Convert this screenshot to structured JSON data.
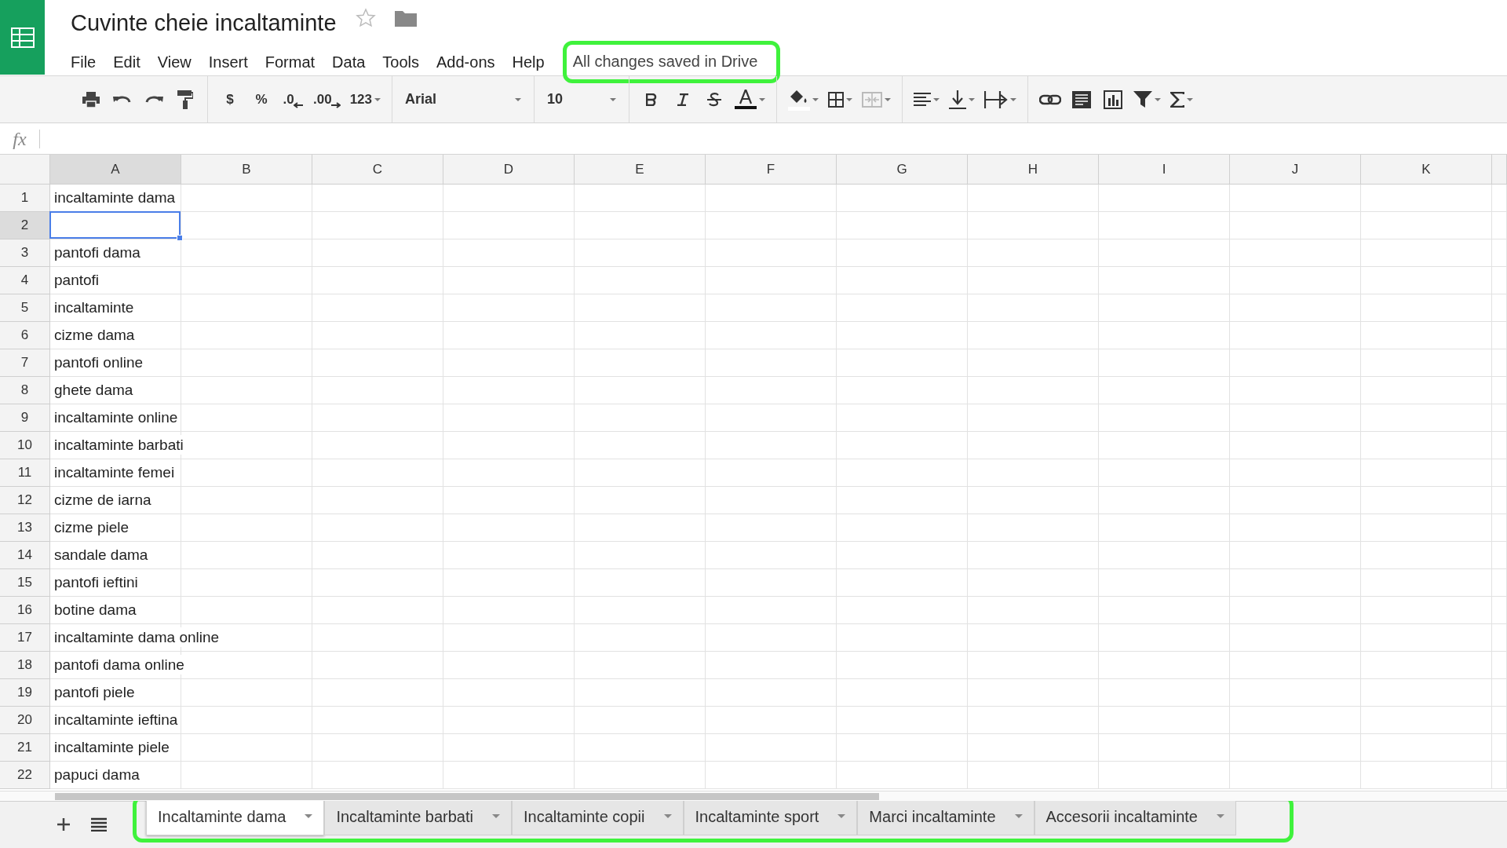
{
  "document": {
    "title": "Cuvinte cheie incaltaminte",
    "starred": false
  },
  "menu": [
    "File",
    "Edit",
    "View",
    "Insert",
    "Format",
    "Data",
    "Tools",
    "Add-ons",
    "Help"
  ],
  "save_status": "All changes saved in Drive",
  "toolbar": {
    "currency": "$",
    "percent": "%",
    "decrease_decimal": ".0",
    "increase_decimal": ".00",
    "number_format": "123",
    "font": "Arial",
    "font_size": "10"
  },
  "formula_bar": {
    "label": "fx"
  },
  "columns": [
    {
      "label": "A",
      "selected": true
    },
    {
      "label": "B",
      "selected": false
    },
    {
      "label": "C",
      "selected": false
    },
    {
      "label": "D",
      "selected": false
    },
    {
      "label": "E",
      "selected": false
    },
    {
      "label": "F",
      "selected": false
    },
    {
      "label": "G",
      "selected": false
    },
    {
      "label": "H",
      "selected": false
    },
    {
      "label": "I",
      "selected": false
    },
    {
      "label": "J",
      "selected": false
    },
    {
      "label": "K",
      "selected": false
    }
  ],
  "rows": [
    {
      "number": "1",
      "value": "incaltaminte dama",
      "selected": false
    },
    {
      "number": "2",
      "selected": true
    },
    {
      "number": "3",
      "value": "pantofi dama",
      "selected": false
    },
    {
      "number": "4",
      "value": "pantofi",
      "selected": false
    },
    {
      "number": "5",
      "value": "incaltaminte",
      "selected": false
    },
    {
      "number": "6",
      "value": "cizme dama",
      "selected": false
    },
    {
      "number": "7",
      "value": "pantofi online",
      "selected": false
    },
    {
      "number": "8",
      "value": "ghete dama",
      "selected": false
    },
    {
      "number": "9",
      "value": "incaltaminte online",
      "selected": false
    },
    {
      "number": "10",
      "value": "incaltaminte barbati",
      "selected": false
    },
    {
      "number": "11",
      "value": "incaltaminte femei",
      "selected": false
    },
    {
      "number": "12",
      "value": "cizme de iarna",
      "selected": false
    },
    {
      "number": "13",
      "value": "cizme piele",
      "selected": false
    },
    {
      "number": "14",
      "value": "sandale dama",
      "selected": false
    },
    {
      "number": "15",
      "value": "pantofi ieftini",
      "selected": false
    },
    {
      "number": "16",
      "value": "botine dama",
      "selected": false
    },
    {
      "number": "17",
      "value": "incaltaminte dama online",
      "selected": false
    },
    {
      "number": "18",
      "value": "pantofi dama online",
      "selected": false
    },
    {
      "number": "19",
      "value": "pantofi piele",
      "selected": false
    },
    {
      "number": "20",
      "value": "incaltaminte ieftina",
      "selected": false
    },
    {
      "number": "21",
      "value": "incaltaminte piele",
      "selected": false
    },
    {
      "number": "22",
      "value": "papuci dama",
      "selected": false
    }
  ],
  "sheet_tabs": [
    {
      "label": "Incaltaminte dama",
      "selected": true
    },
    {
      "label": "Incaltaminte barbati",
      "selected": false
    },
    {
      "label": "Incaltaminte copii",
      "selected": false
    },
    {
      "label": "Incaltaminte sport",
      "selected": false
    },
    {
      "label": "Marci incaltaminte",
      "selected": false
    },
    {
      "label": "Accesorii incaltaminte",
      "selected": false
    }
  ]
}
